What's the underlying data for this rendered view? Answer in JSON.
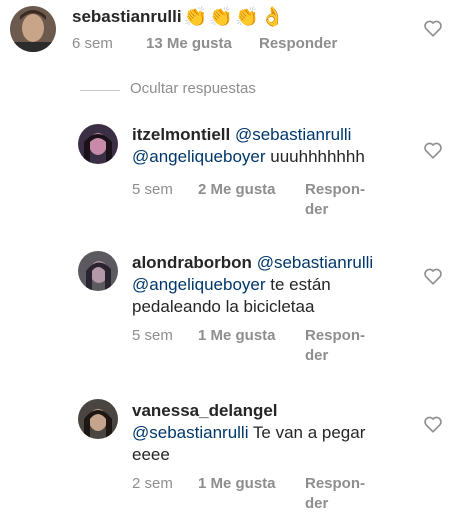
{
  "main_comment": {
    "username": "sebastianrulli",
    "emojis": [
      "👏",
      "👏",
      "👏",
      "👌"
    ],
    "time": "6 sem",
    "likes": "13 Me gusta",
    "reply": "Responder"
  },
  "toggle_replies": "Ocultar respuestas",
  "replies": [
    {
      "username": "itzelmontiell",
      "mention1": "@sebastianrulli",
      "mention2": "@angeliqueboyer",
      "text": " uuuhhhhhhh",
      "time": "5 sem",
      "likes": "2 Me gusta",
      "reply_line1": "Respon-",
      "reply_line2": "der"
    },
    {
      "username": "alondraborbon",
      "mention1": "@sebastianrulli",
      "mention2": "@angeliqueboyer",
      "text1": "  te están",
      "text2": "pedaleando la bicicletaa",
      "time": "5 sem",
      "likes": "1 Me gusta",
      "reply_line1": "Respon-",
      "reply_line2": "der"
    },
    {
      "username": "vanessa_delangel",
      "mention1": "@sebastianrulli",
      "text1": "  Te van a pegar",
      "text2": "eeee",
      "time": "2 sem",
      "likes": "1 Me gusta",
      "reply_line1": "Respon-",
      "reply_line2": "der"
    }
  ],
  "colors": {
    "username": "#262626",
    "mention": "#00376b",
    "meta": "#8e8e8e",
    "heart_stroke": "#8e8e8e"
  },
  "icons": [
    "heart-outline-icon"
  ]
}
